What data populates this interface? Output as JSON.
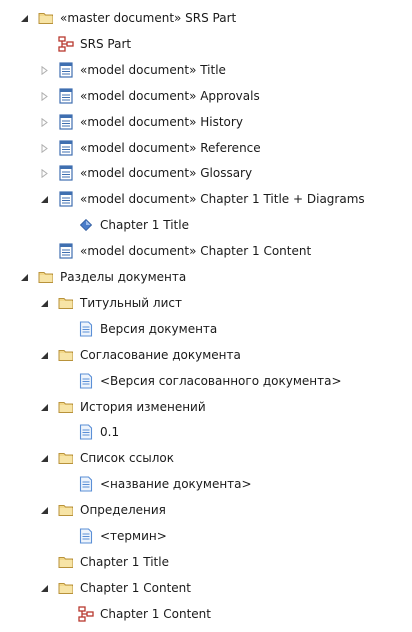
{
  "tree": {
    "nodes": [
      {
        "label": "«master document» SRS Part",
        "icon": "folder-icon",
        "toggle": "expanded",
        "level": 0
      },
      {
        "label": "SRS Part",
        "icon": "diagram-icon",
        "toggle": "none",
        "level": 1
      },
      {
        "label": "«model document» Title",
        "icon": "model-document-icon",
        "toggle": "collapsed",
        "level": 1
      },
      {
        "label": "«model document» Approvals",
        "icon": "model-document-icon",
        "toggle": "collapsed",
        "level": 1
      },
      {
        "label": "«model document» History",
        "icon": "model-document-icon",
        "toggle": "collapsed",
        "level": 1
      },
      {
        "label": "«model document» Reference",
        "icon": "model-document-icon",
        "toggle": "collapsed",
        "level": 1
      },
      {
        "label": "«model document» Glossary",
        "icon": "model-document-icon",
        "toggle": "collapsed",
        "level": 1
      },
      {
        "label": "«model document» Chapter 1 Title + Diagrams",
        "icon": "model-document-icon",
        "toggle": "expanded",
        "level": 1
      },
      {
        "label": "Chapter 1 Title",
        "icon": "element-diamond-icon",
        "toggle": "none",
        "level": 2
      },
      {
        "label": "«model document» Chapter 1 Content",
        "icon": "model-document-icon",
        "toggle": "none",
        "level": 1
      },
      {
        "label": "Разделы документа",
        "icon": "folder-icon",
        "toggle": "expanded",
        "level": 0
      },
      {
        "label": "Титульный лист",
        "icon": "folder-icon",
        "toggle": "expanded",
        "level": 1
      },
      {
        "label": "Версия документа",
        "icon": "note-icon",
        "toggle": "none",
        "level": 2
      },
      {
        "label": "Согласование документа",
        "icon": "folder-icon",
        "toggle": "expanded",
        "level": 1
      },
      {
        "label": "<Версия согласованного документа>",
        "icon": "note-icon",
        "toggle": "none",
        "level": 2
      },
      {
        "label": "История изменений",
        "icon": "folder-icon",
        "toggle": "expanded",
        "level": 1
      },
      {
        "label": "0.1",
        "icon": "note-icon",
        "toggle": "none",
        "level": 2
      },
      {
        "label": "Список ссылок",
        "icon": "folder-icon",
        "toggle": "expanded",
        "level": 1
      },
      {
        "label": "<название документа>",
        "icon": "note-icon",
        "toggle": "none",
        "level": 2
      },
      {
        "label": "Определения",
        "icon": "folder-icon",
        "toggle": "expanded",
        "level": 1
      },
      {
        "label": "<термин>",
        "icon": "note-icon",
        "toggle": "none",
        "level": 2
      },
      {
        "label": "Chapter 1 Title",
        "icon": "folder-icon",
        "toggle": "none",
        "level": 1
      },
      {
        "label": "Chapter 1 Content",
        "icon": "folder-icon",
        "toggle": "expanded",
        "level": 1
      },
      {
        "label": "Chapter 1 Content",
        "icon": "diagram-icon",
        "toggle": "none",
        "level": 2
      }
    ]
  },
  "colors": {
    "folder_fill": "#f2d88a",
    "folder_stroke": "#b8923a",
    "diagram_red": "#b8382e",
    "doc_blue": "#3f6fb0",
    "diamond_blue": "#4a7cc9",
    "note_blue": "#5b8fd6",
    "arrow_dark": "#333333",
    "arrow_light": "#b0b0b0"
  }
}
